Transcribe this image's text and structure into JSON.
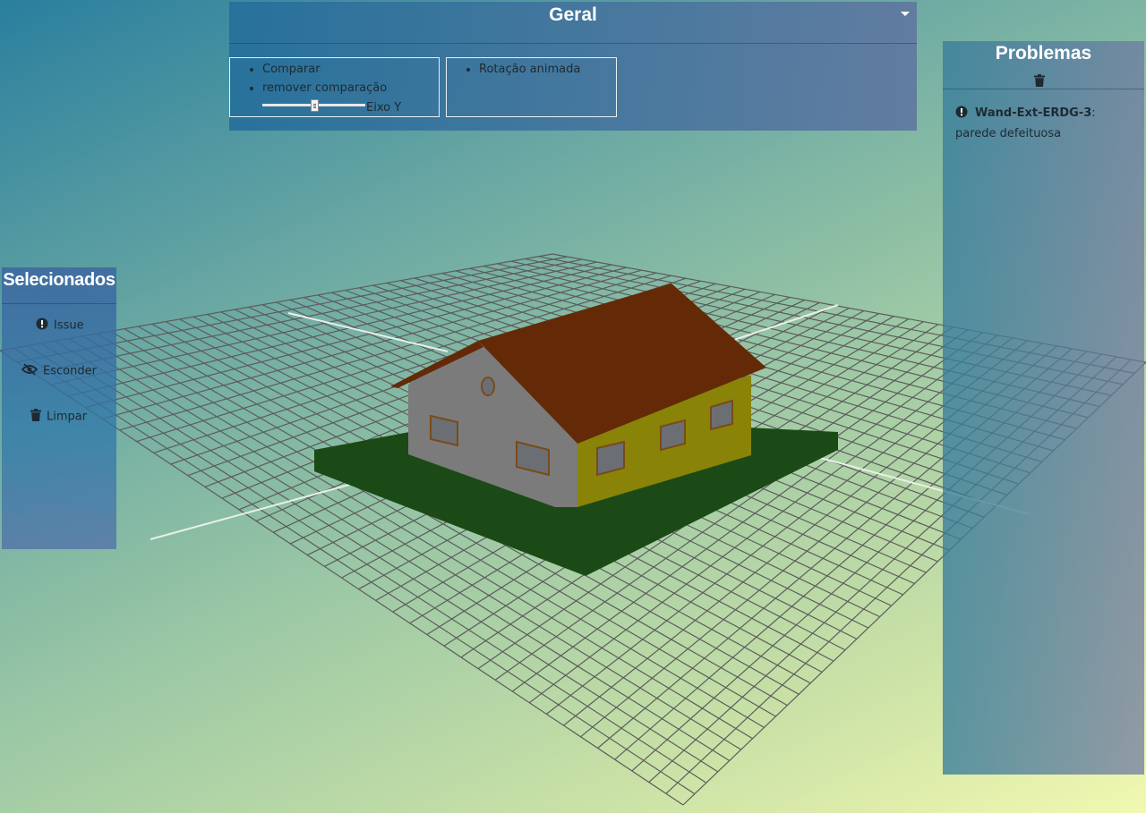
{
  "colors": {
    "roof": "#642a08",
    "wall_front": "#898308",
    "wall_side": "#7b7b7b",
    "ground": "#1c4a16",
    "grid": "#5c5c5c"
  },
  "geral": {
    "title": "Geral",
    "list1": [
      "Comparar",
      "remover comparação"
    ],
    "slider_label": "Eixo Y",
    "slider_value": 0.5,
    "list2": [
      "Rotação animada"
    ],
    "expand_icon": "caret-down-icon"
  },
  "selecionados": {
    "title": "Selecionados",
    "items": [
      {
        "label": "Issue",
        "icon": "exclamation-circle-icon"
      },
      {
        "label": "Esconder",
        "icon": "eye-slash-icon"
      },
      {
        "label": "Limpar",
        "icon": "trash-icon"
      }
    ]
  },
  "problemas": {
    "title": "Problemas",
    "clear_icon": "trash-icon",
    "items": [
      {
        "id": "Wand-Ext-ERDG-3",
        "separator": ":",
        "text": "parede defeituosa",
        "icon": "exclamation-circle-icon"
      }
    ]
  }
}
